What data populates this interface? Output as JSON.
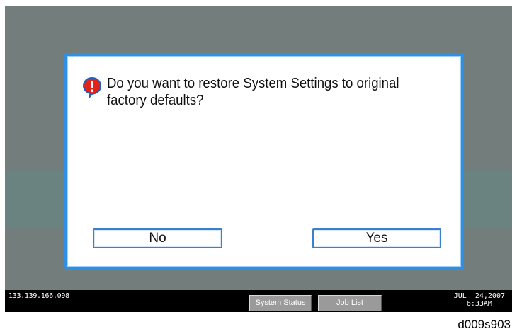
{
  "dialog": {
    "message": "Do you want to restore System Settings to original factory defaults?",
    "icon": "exclamation-bubble-icon",
    "no_label": "No",
    "yes_label": "Yes"
  },
  "status_bar": {
    "ip_address": "133.139.166.098",
    "system_status_label": "System Status",
    "job_list_label": "Job List",
    "date": "JUL  24,2007",
    "time": "6:33AM"
  },
  "caption": "d009s903",
  "colors": {
    "screen_background": "#737d7b",
    "dialog_border": "#2e8fe6",
    "icon_fill": "#e2231a",
    "status_bar": "#000000"
  }
}
